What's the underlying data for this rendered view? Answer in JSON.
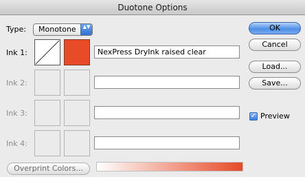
{
  "window": {
    "title": "Duotone Options"
  },
  "type_select": {
    "label": "Type:",
    "value": "Monotone",
    "arrows": "▲▼"
  },
  "inks": [
    {
      "label": "Ink 1:",
      "name": "NexPress DryInk raised clear",
      "color": "#e74b28"
    },
    {
      "label": "Ink 2:",
      "name": ""
    },
    {
      "label": "Ink 3:",
      "name": ""
    },
    {
      "label": "Ink 4:",
      "name": ""
    }
  ],
  "buttons": {
    "ok": "OK",
    "cancel": "Cancel",
    "load": "Load...",
    "save": "Save...",
    "overprint": "Overprint Colors..."
  },
  "preview": {
    "label": "Preview",
    "checked": true,
    "mark": "✓"
  },
  "colors": {
    "accent": "#4f8fe6",
    "ink1": "#e74b28"
  }
}
